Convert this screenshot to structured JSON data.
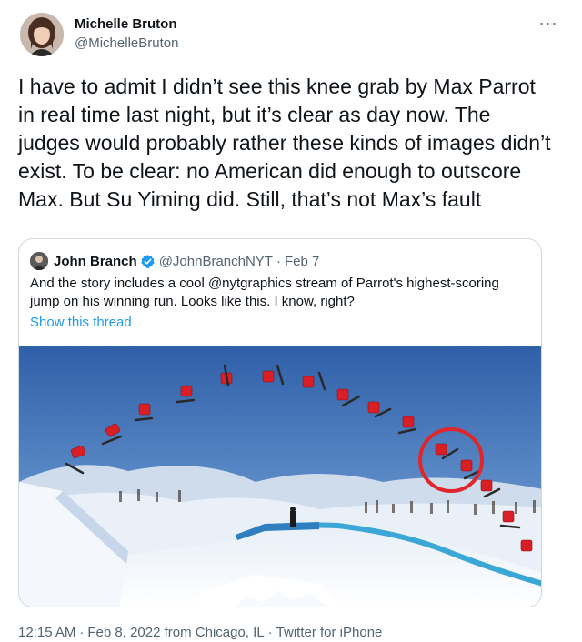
{
  "author": {
    "display_name": "Michelle Bruton",
    "handle": "@MichelleBruton",
    "avatar_icon": "profile-photo"
  },
  "more_icon": "ellipsis-icon",
  "tweet_text": "I have to admit I didn’t see this knee grab by Max Parrot in real time last night, but it’s clear as day now. The judges would probably rather these kinds of images didn’t exist. To be clear: no American did enough to outscore Max. But Su Yiming did. Still, that’s not Max’s fault",
  "quote": {
    "display_name": "John Branch",
    "handle": "@JohnBranchNYT",
    "dot": "·",
    "date": "Feb 7",
    "text": "And the story includes a cool @nytgraphics stream of Parrot's highest-scoring jump on his winning run. Looks like this. I know, right?",
    "show_thread": "Show this thread",
    "image": "snowboard-jump-sequence-photo"
  },
  "footer": {
    "time": "12:15 AM",
    "date": "Feb 8, 2022 from Chicago, IL",
    "client": "Twitter for iPhone",
    "sep": "·"
  },
  "colors": {
    "link": "#1d9bf0",
    "secondary_text": "#536471",
    "border": "#cfd9de",
    "highlight_circle": "#e0262b"
  }
}
